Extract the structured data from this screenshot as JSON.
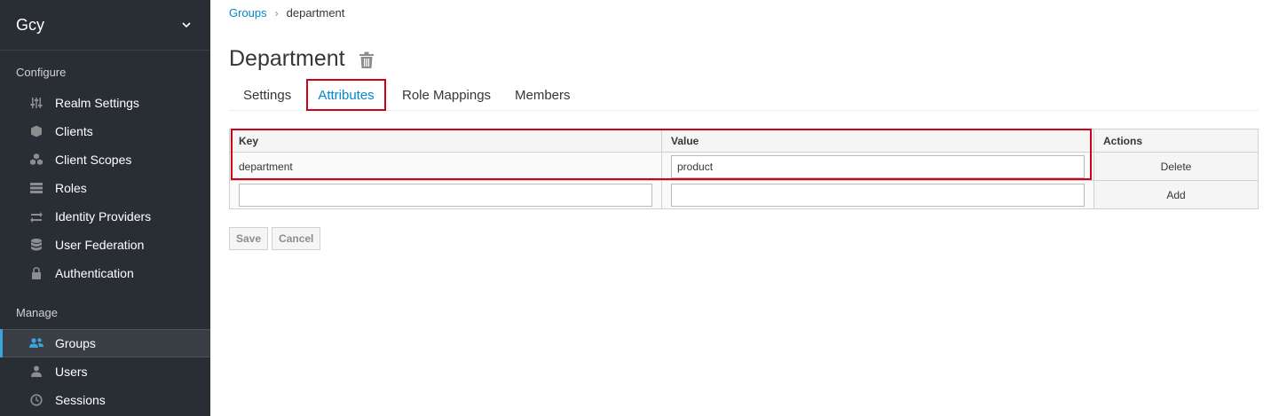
{
  "sidebar": {
    "realm": "Gcy",
    "configure_title": "Configure",
    "configure_items": [
      {
        "label": "Realm Settings",
        "icon": "sliders-icon"
      },
      {
        "label": "Clients",
        "icon": "cube-icon"
      },
      {
        "label": "Client Scopes",
        "icon": "cubes-icon"
      },
      {
        "label": "Roles",
        "icon": "list-icon"
      },
      {
        "label": "Identity Providers",
        "icon": "exchange-icon"
      },
      {
        "label": "User Federation",
        "icon": "database-icon"
      },
      {
        "label": "Authentication",
        "icon": "lock-icon"
      }
    ],
    "manage_title": "Manage",
    "manage_items": [
      {
        "label": "Groups",
        "icon": "users-icon",
        "active": true
      },
      {
        "label": "Users",
        "icon": "user-icon"
      },
      {
        "label": "Sessions",
        "icon": "clock-icon"
      }
    ]
  },
  "breadcrumb": {
    "parent": "Groups",
    "separator": "›",
    "current": "department"
  },
  "page": {
    "title": "Department"
  },
  "tabs": [
    {
      "label": "Settings"
    },
    {
      "label": "Attributes",
      "active": true
    },
    {
      "label": "Role Mappings"
    },
    {
      "label": "Members"
    }
  ],
  "table": {
    "headers": {
      "key": "Key",
      "value": "Value",
      "actions": "Actions"
    },
    "rows": [
      {
        "key": "department",
        "value": "product",
        "action": "Delete"
      }
    ],
    "new_row": {
      "key": "",
      "value": "",
      "action": "Add"
    }
  },
  "buttons": {
    "save": "Save",
    "cancel": "Cancel"
  },
  "colors": {
    "sidebar_bg": "#292e34",
    "accent": "#0088ce",
    "highlight": "#d0021b",
    "active_bar": "#39a5dc"
  }
}
